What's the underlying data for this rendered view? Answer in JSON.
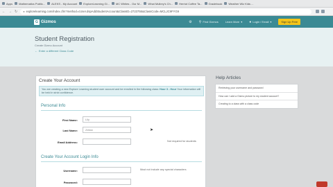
{
  "bookmarks": [
    {
      "label": "Apps"
    },
    {
      "label": "Mathematics Public..."
    },
    {
      "label": "ALEKS - My Account"
    },
    {
      "label": "ExploreLearning Gi..."
    },
    {
      "label": "MC Whites - Our M..."
    },
    {
      "label": "What Mullrey's Ch..."
    },
    {
      "label": "Herriot Coffee Ta..."
    },
    {
      "label": "Gradebook"
    },
    {
      "label": "Weather Wiz Kids ..."
    }
  ],
  "address_bar": {
    "url": "explorelearning.com/index.cfm?method=cUser.dspAddStudentAccount&ClassID=2723755&ClassCode=MCLJC9FYG9"
  },
  "header": {
    "logo_text": "Gizmos",
    "find_gizmos": "Find Gizmos",
    "learn_more": "Learn More",
    "login": "Login / Email",
    "signup": "Sign Up Free"
  },
  "title_band": {
    "title": "Student Registration",
    "subtitle": "Create Gizmo Account",
    "link": "Enter a different Class Code"
  },
  "form": {
    "card_title": "Create Your Account",
    "notice_prefix": "You are creating a new Explore Learning student user account and be enrolled in the following class:",
    "notice_class": "Hour 3 - Hour",
    "notice_suffix": "Your information will be held in strict confidence.",
    "personal_info": "Personal Info",
    "first_name_label": "First Name:",
    "first_name_value": "Lily",
    "last_name_label": "Last Name:",
    "last_name_value": "Zeilan",
    "email_label": "Email Address:",
    "email_note": "Not required for students",
    "login_info": "Create Your Account Login Info",
    "username_label": "Username:",
    "username_note": "Must not include any special characters",
    "password_label": "Password:"
  },
  "help": {
    "title": "Help Articles",
    "items": [
      "Retrieving your username and password",
      "How can I add a Gizmo picture to my student account?",
      "Creating to a class with a class code"
    ]
  },
  "colors": {
    "header_teal": "#3b8a94",
    "signup_yellow": "#f5c518",
    "title_band": "#e7f1f2"
  }
}
